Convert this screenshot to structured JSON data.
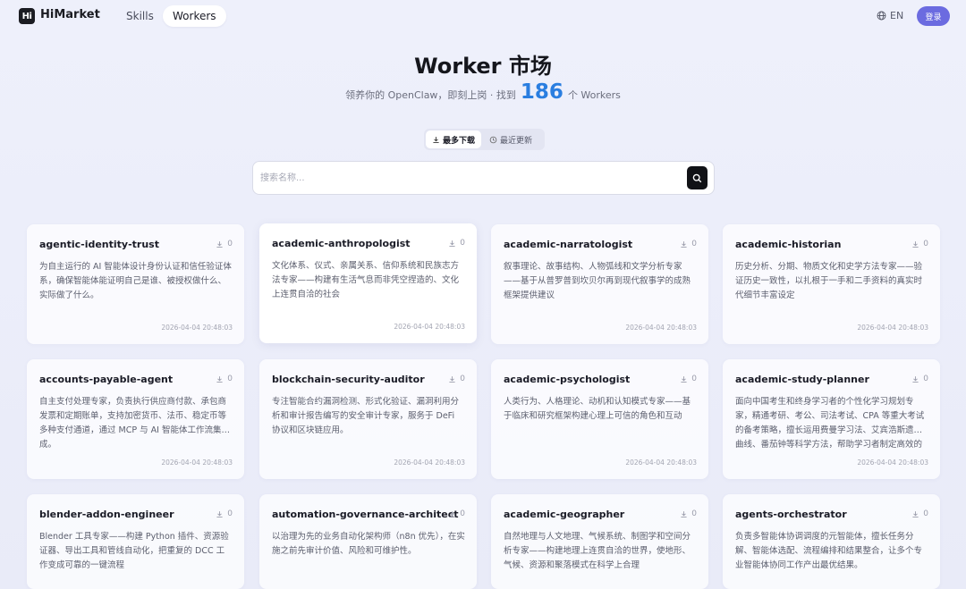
{
  "nav": {
    "logo_mark": "Hi",
    "brand": "HiMarket",
    "tabs": [
      {
        "label": "Skills",
        "active": false
      },
      {
        "label": "Workers",
        "active": true
      }
    ],
    "lang": "EN",
    "lang_icon": "globe-icon",
    "login": "登录",
    "accent": "#6b6be0"
  },
  "hero": {
    "title": "Worker 市场",
    "sub_before": "领养你的 OpenClaw，即刻上岗 · 找到",
    "count": "186",
    "sub_after": "个 Workers",
    "count_color": "#2a7ee0"
  },
  "sort": {
    "options": [
      {
        "label": "最多下载",
        "icon": "download-icon",
        "active": true
      },
      {
        "label": "最近更新",
        "icon": "clock-icon",
        "active": false
      }
    ]
  },
  "search": {
    "placeholder": "搜索名称...",
    "value": "",
    "button_icon": "search-icon"
  },
  "cards": [
    {
      "title": "agentic-identity-trust",
      "downloads": "0",
      "desc": "为自主运行的 AI 智能体设计身份认证和信任验证体系，确保智能体能证明自己是谁、被授权做什么、实际做了什么。",
      "date": "2026-04-04 20:48:03"
    },
    {
      "title": "academic-anthropologist",
      "downloads": "0",
      "desc": "文化体系、仪式、亲属关系、信仰系统和民族志方法专家——构建有生活气息而非凭空捏造的、文化上连贯自洽的社会",
      "date": "2026-04-04 20:48:03"
    },
    {
      "title": "academic-narratologist",
      "downloads": "0",
      "desc": "叙事理论、故事结构、人物弧线和文学分析专家——基于从普罗普到坎贝尔再到现代叙事学的成熟框架提供建议",
      "date": "2026-04-04 20:48:03"
    },
    {
      "title": "academic-historian",
      "downloads": "0",
      "desc": "历史分析、分期、物质文化和史学方法专家——验证历史一致性，以扎根于一手和二手资料的真实时代细节丰富设定",
      "date": "2026-04-04 20:48:03"
    },
    {
      "title": "accounts-payable-agent",
      "downloads": "0",
      "desc": "自主支付处理专家，负责执行供应商付款、承包商发票和定期账单，支持加密货币、法币、稳定币等多种支付通道，通过 MCP 与 AI 智能体工作流集…成。",
      "date": "2026-04-04 20:48:03"
    },
    {
      "title": "blockchain-security-auditor",
      "downloads": "0",
      "desc": "专注智能合约漏洞检测、形式化验证、漏洞利用分析和审计报告编写的安全审计专家，服务于 DeFi 协议和区块链应用。",
      "date": "2026-04-04 20:48:03"
    },
    {
      "title": "academic-psychologist",
      "downloads": "0",
      "desc": "人类行为、人格理论、动机和认知模式专家——基于临床和研究框架构建心理上可信的角色和互动",
      "date": "2026-04-04 20:48:03"
    },
    {
      "title": "academic-study-planner",
      "downloads": "0",
      "desc": "面向中国考生和终身学习者的个性化学习规划专家，精通考研、考公、司法考试、CPA 等重大考试的备考策略，擅长运用费曼学习法、艾宾浩斯遗…曲线、番茄钟等科学方法，帮助学习者制定高效的",
      "date": "2026-04-04 20:48:03"
    },
    {
      "title": "blender-addon-engineer",
      "downloads": "0",
      "desc": "Blender 工具专家——构建 Python 插件、资源验证器、导出工具和管线自动化，把重复的 DCC 工作变成可靠的一键流程",
      "date": ""
    },
    {
      "title": "automation-governance-architect",
      "downloads": "0",
      "desc": "以治理为先的业务自动化架构师（n8n 优先），在实施之前先审计价值、风险和可维护性。",
      "date": ""
    },
    {
      "title": "academic-geographer",
      "downloads": "0",
      "desc": "自然地理与人文地理、气候系统、制图学和空间分析专家——构建地理上连贯自洽的世界，使地形、气候、资源和聚落模式在科学上合理",
      "date": ""
    },
    {
      "title": "agents-orchestrator",
      "downloads": "0",
      "desc": "负责多智能体协调调度的元智能体，擅长任务分解、智能体选配、流程编排和结果整合，让多个专业智能体协同工作产出最优结果。",
      "date": ""
    }
  ]
}
